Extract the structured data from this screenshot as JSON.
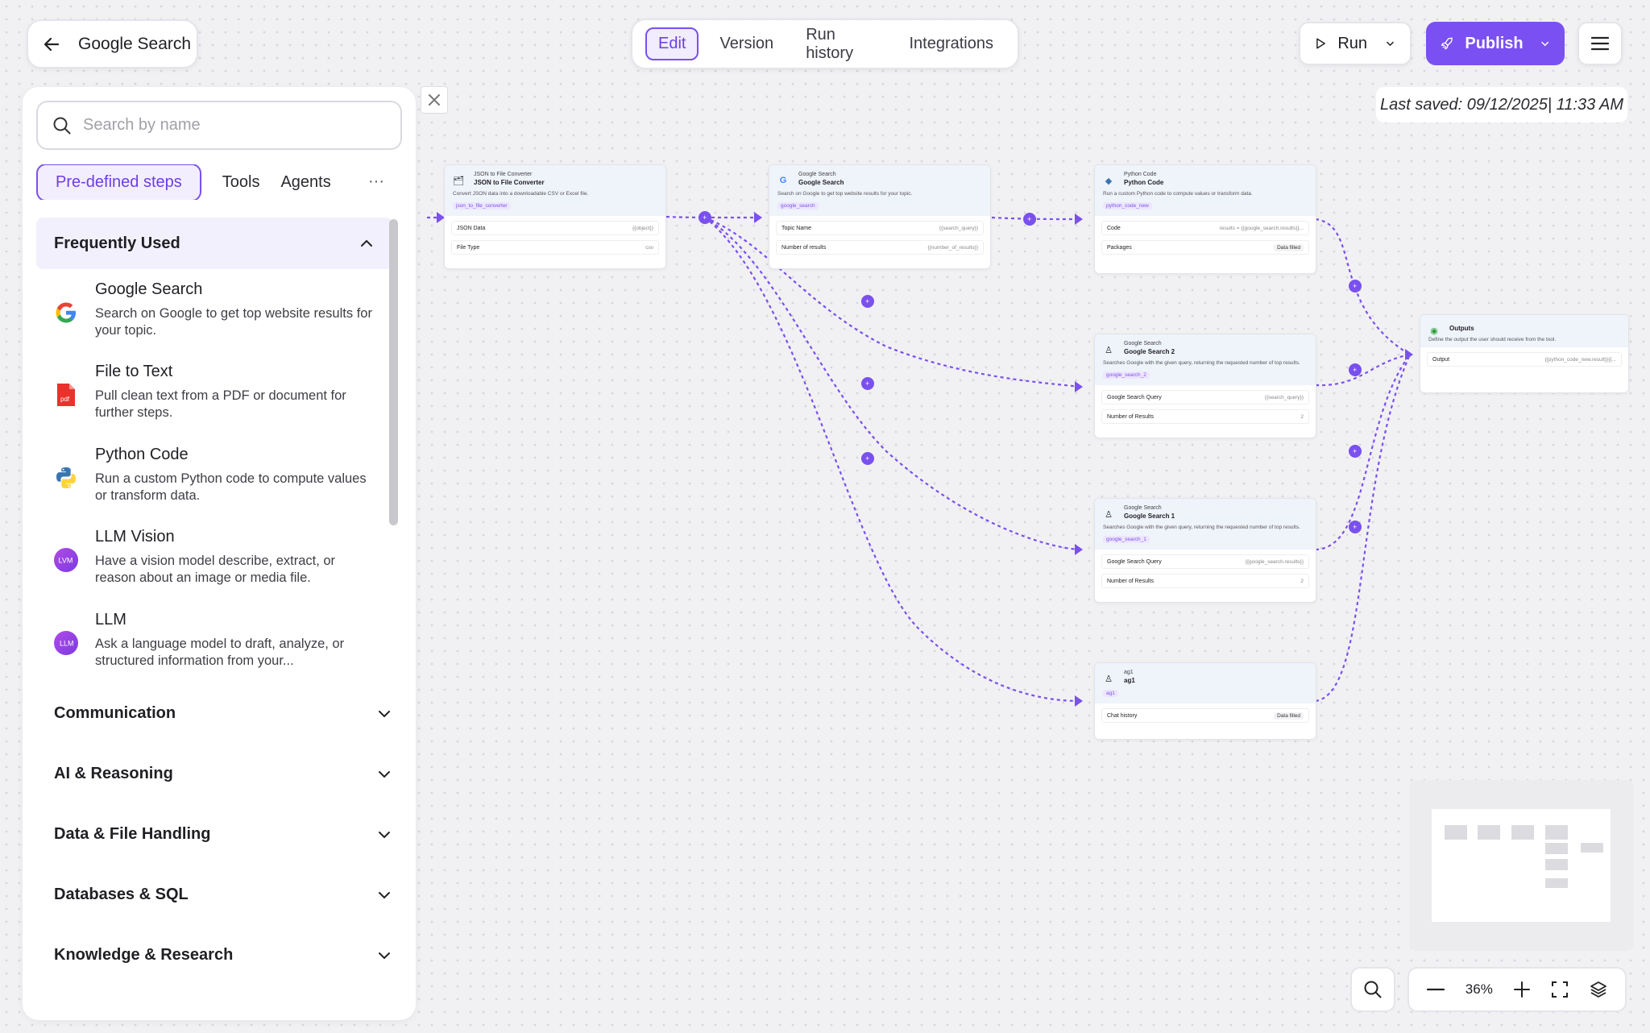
{
  "header": {
    "back_title": "Google Search",
    "tabs": [
      {
        "label": "Edit",
        "active": true
      },
      {
        "label": "Version"
      },
      {
        "label": "Run history"
      },
      {
        "label": "Integrations"
      }
    ],
    "run_label": "Run",
    "publish_label": "Publish",
    "last_saved": "Last saved: 09/12/2025| 11:33 AM"
  },
  "panel": {
    "search_placeholder": "Search by name",
    "tabs": [
      "Pre-defined steps",
      "Tools",
      "Agents"
    ],
    "more": "···",
    "frequently_used": "Frequently Used",
    "steps": [
      {
        "title": "Google Search",
        "desc": "Search on Google to get top website results for your topic.",
        "icon": "google-icon"
      },
      {
        "title": "File to Text",
        "desc": "Pull clean text from a PDF or document for further steps.",
        "icon": "pdf-icon"
      },
      {
        "title": "Python Code",
        "desc": "Run a custom Python code to compute values or transform data.",
        "icon": "python-icon"
      },
      {
        "title": "LLM Vision",
        "desc": "Have a vision model describe, extract, or reason about an image or media file.",
        "icon": "llm-vision-icon"
      },
      {
        "title": "LLM",
        "desc": "Ask a language model to draft, analyze, or structured information from your...",
        "icon": "llm-icon"
      }
    ],
    "categories": [
      "Communication",
      "AI & Reasoning",
      "Data & File Handling",
      "Databases & SQL",
      "Knowledge & Research"
    ]
  },
  "nodes": {
    "json": {
      "sub": "JSON to File Converter",
      "title": "JSON to File Converter",
      "desc": "Convert JSON data into a downloadable CSV or Excel file.",
      "tag": "json_to_file_converter",
      "f1": "JSON Data",
      "v1": "{{object}}",
      "f2": "File Type",
      "v2": "csv"
    },
    "google": {
      "sub": "Google Search",
      "title": "Google Search",
      "desc": "Search on Google to get top website results for your topic.",
      "tag": "google_search",
      "f1": "Topic Name",
      "v1": "{{search_query}}",
      "f2": "Number of results",
      "v2": "{{number_of_results}}"
    },
    "python": {
      "sub": "Python Code",
      "title": "Python Code",
      "desc": "Run a custom Python code to compute values or transform data.",
      "tag": "python_code_new",
      "f1": "Code",
      "v1": "results = {{google_search.results}}...",
      "f2": "Packages",
      "v2": "Data filled"
    },
    "gs2": {
      "sub": "Google Search",
      "title": "Google Search 2",
      "desc": "Searches Google with the given query, returning the requested number of top results.",
      "tag": "google_search_2",
      "f1": "Google Search Query",
      "v1": "{{search_query}}",
      "f2": "Number of Results",
      "v2": "2"
    },
    "gs1": {
      "sub": "Google Search",
      "title": "Google Search 1",
      "desc": "Searches Google with the given query, returning the requested number of top results.",
      "tag": "google_search_1",
      "f1": "Google Search Query",
      "v1": "{{google_search.results}}",
      "f2": "Number of Results",
      "v2": "2"
    },
    "ag1": {
      "sub": "ag1",
      "title": "ag1",
      "tag": "ag1",
      "f1": "Chat history",
      "v1": "Data filled"
    },
    "outputs": {
      "title": "Outputs",
      "desc": "Define the output the user should receive from the tool.",
      "f1": "Output",
      "v1": "{{python_code_new.result}}{{..."
    }
  },
  "zoom": {
    "level": "36%"
  }
}
